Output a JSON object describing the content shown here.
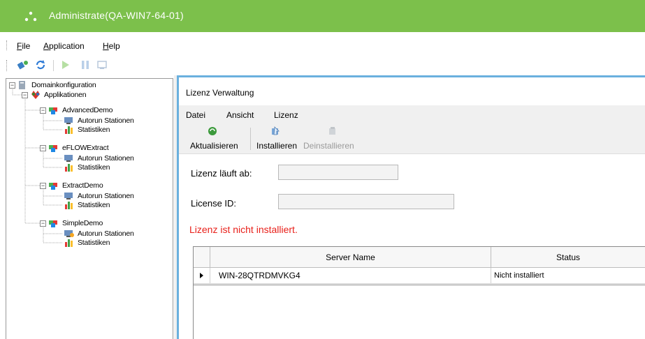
{
  "window": {
    "title": "Administrate(QA-WIN7-64-01)"
  },
  "menu": {
    "items": [
      "File",
      "Application",
      "Help"
    ]
  },
  "toolbar": {
    "icons": [
      "connect-icon",
      "refresh-icon",
      "play-icon",
      "pause-icon",
      "stations-icon"
    ]
  },
  "tree": {
    "root": "Domainkonfiguration",
    "applications_label": "Applikationen",
    "apps": [
      {
        "name": "AdvancedDemo",
        "children": [
          "Autorun Stationen",
          "Statistiken"
        ]
      },
      {
        "name": "eFLOWExtract",
        "children": [
          "Autorun Stationen",
          "Statistiken"
        ]
      },
      {
        "name": "ExtractDemo",
        "children": [
          "Autorun Stationen",
          "Statistiken"
        ]
      },
      {
        "name": "SimpleDemo",
        "children": [
          "Autorun Stationen",
          "Statistiken"
        ]
      }
    ]
  },
  "panel": {
    "title": "Lizenz Verwaltung",
    "menu": [
      "Datei",
      "Ansicht",
      "Lizenz"
    ],
    "buttons": [
      {
        "label": "Aktualisieren",
        "enabled": true
      },
      {
        "label": "Installieren",
        "enabled": true
      },
      {
        "label": "Deinstallieren",
        "enabled": false
      }
    ],
    "fields": {
      "expires_label": "Lizenz läuft ab:",
      "expires_value": "",
      "license_id_label": "License ID:",
      "license_id_value": ""
    },
    "warning": "Lizenz ist nicht installiert.",
    "warning_color": "#e8201a",
    "grid": {
      "columns": [
        "Server Name",
        "Status"
      ],
      "rows": [
        {
          "server": "WIN-28QTRDMVKG4",
          "status": "Nicht installiert"
        }
      ]
    }
  },
  "colors": {
    "titlebar": "#7cc04b",
    "panel_border": "#6ab0de"
  }
}
